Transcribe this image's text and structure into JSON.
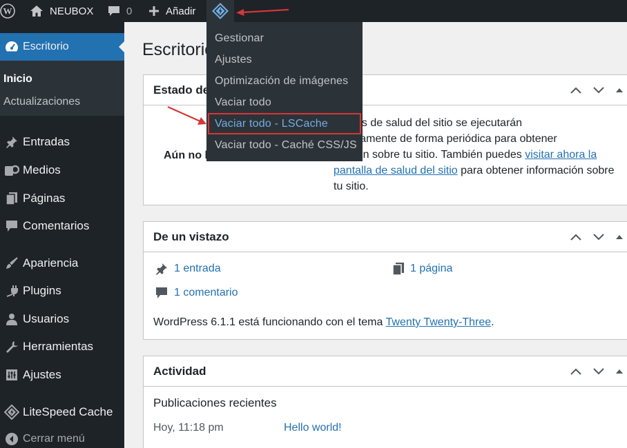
{
  "adminbar": {
    "site_name": "NEUBOX",
    "comments_count": "0",
    "add_new": "Añadir"
  },
  "dropdown": {
    "items": [
      "Gestionar",
      "Ajustes",
      "Optimización de imágenes",
      "Vaciar todo",
      "Vaciar todo - LSCache",
      "Vaciar todo - Caché CSS/JS"
    ]
  },
  "sidebar": {
    "current": "Escritorio",
    "submenu": [
      "Inicio",
      "Actualizaciones"
    ],
    "items": [
      "Entradas",
      "Medios",
      "Páginas",
      "Comentarios",
      "Apariencia",
      "Plugins",
      "Usuarios",
      "Herramientas",
      "Ajustes",
      "LiteSpeed Cache"
    ],
    "collapse": "Cerrar menú"
  },
  "main": {
    "title": "Escritorio",
    "health": {
      "title": "Estado de",
      "left_text": "Aún no h",
      "line1": "ruebas de salud del sitio se ejecutarán",
      "line2": "máticamente de forma periódica para obtener",
      "line3_pre": "mación sobre tu sitio. También puedes ",
      "link_part1": "visitar ahora la",
      "link_part2": "pantalla de salud del sitio",
      "line4_post": " para obtener información sobre",
      "line5": "tu sitio."
    },
    "glance": {
      "title": "De un vistazo",
      "posts": "1 entrada",
      "pages": "1 página",
      "comments": "1 comentario",
      "wp_pre": "WordPress 6.1.1 está funcionando con el tema ",
      "theme": "Twenty Twenty-Three",
      "wp_post": "."
    },
    "activity": {
      "title": "Actividad",
      "recent_heading": "Publicaciones recientes",
      "post_date": "Hoy, 11:18 pm",
      "post_title": "Hello world!"
    }
  },
  "colors": {
    "adminbar_bg": "#1d2327",
    "highlight": "#2271b1",
    "annotation": "#d63638"
  }
}
